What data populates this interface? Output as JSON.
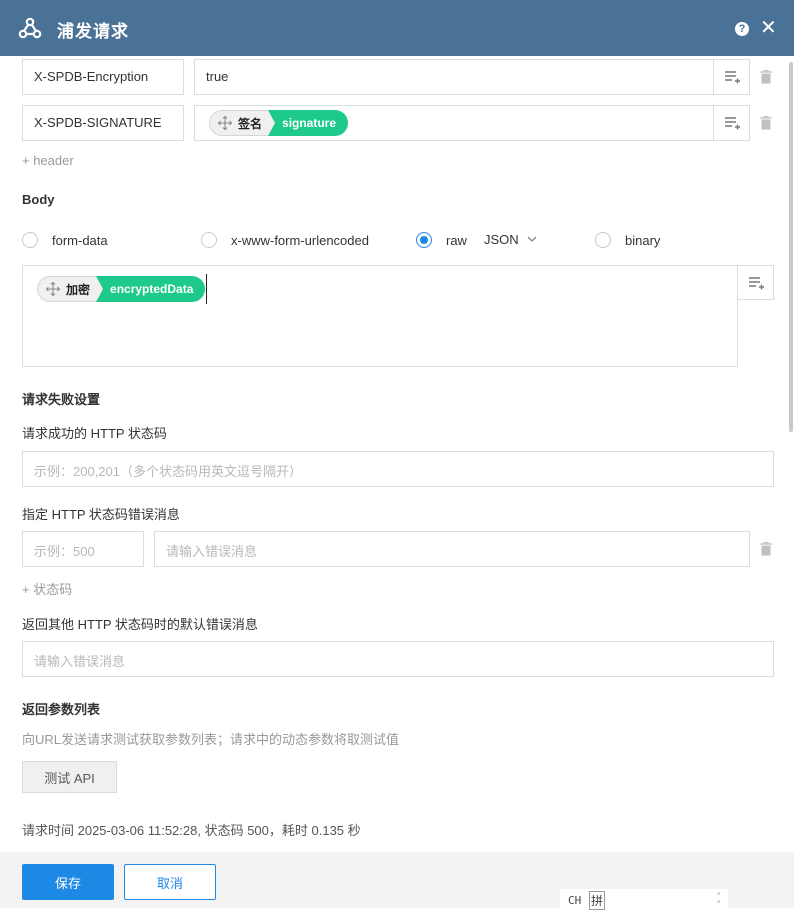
{
  "window": {
    "title": "浦发请求",
    "help_label": "?",
    "close_label": "✕"
  },
  "headers": [
    {
      "key": "X-SPDB-Encryption",
      "value": "true"
    },
    {
      "key": "X-SPDB-SIGNATURE",
      "tag_label": "签名",
      "tag_value": "signature"
    }
  ],
  "add_header_label": "+ header",
  "body": {
    "heading": "Body",
    "options": [
      "form-data",
      "x-www-form-urlencoded",
      "raw",
      "binary"
    ],
    "selected": "raw",
    "format": "JSON",
    "tag_label": "加密",
    "tag_value": "encryptedData"
  },
  "failure": {
    "heading": "请求失败设置",
    "success_code_label": "请求成功的 HTTP 状态码",
    "success_code_placeholder": "示例：200,201（多个状态码用英文逗号隔开）",
    "error_msg_label": "指定 HTTP 状态码错误消息",
    "code_placeholder": "示例：500",
    "msg_placeholder": "请输入错误消息",
    "add_code_label": "+ 状态码",
    "default_msg_label": "返回其他 HTTP 状态码时的默认错误消息",
    "default_msg_placeholder": "请输入错误消息"
  },
  "params": {
    "heading": "返回参数列表",
    "description": "向URL发送请求测试获取参数列表；请求中的动态参数将取测试值",
    "test_button": "测试 API",
    "status_text": "请求时间 2025-03-06 11:52:28, 状态码 500，耗时 0.135 秒"
  },
  "footer": {
    "save": "保存",
    "cancel": "取消"
  },
  "ime": {
    "lang": "CH",
    "mode": "拼"
  },
  "colors": {
    "titlebar": "#4a7196",
    "primary": "#1e88e5",
    "tag_green": "#1ec98c"
  }
}
